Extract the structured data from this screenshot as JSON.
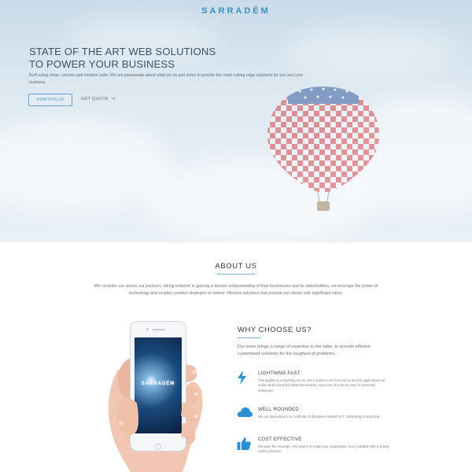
{
  "header": {
    "logo": "SARRADÉM"
  },
  "hero": {
    "title_line1": "STATE OF THE ART WEB SOLUTIONS",
    "title_line2": "TO POWER YOUR BUSINESS",
    "subtitle": "Built using clean, concise and modern code. We are passionate about what we do and strive to provide the most cutting edge solutions for you and your business.",
    "portfolio_button": "PORTFOLIO",
    "quote_button": "GET QUOTE",
    "quote_icon": "chevron-down-icon"
  },
  "about": {
    "title": "ABOUT US",
    "text": "We consider our clients our partners; taking initiative in gaining a deeper understanding of their businesses and its stakeholders, we leverage the power of technology and employ creative strategies to deliver effective solutions that provide our clients with significant value."
  },
  "phone": {
    "screen_logo": "SARRADÉM"
  },
  "why": {
    "title": "WHY CHOOSE US?",
    "text": "Our team brings a range of expertise to the table, to provide efficient, customised solutions for the toughest of problems.",
    "features": [
      {
        "icon": "lightning-bolt-icon",
        "title": "LIGHTNING FAST",
        "text": "This applies to everything we do: we're quick on our feet and so are the applications we make! Build using the latest frameworks, every line of code we write is extremely deliberate!"
      },
      {
        "icon": "cloud-icon",
        "title": "WELL ROUNDED",
        "text": "We are specialized in a multitude of disciplines related to IT, Advertising & Branding."
      },
      {
        "icon": "thumbs-up-icon",
        "title": "COST EFFECTIVE",
        "text": "We push the envelope. Our goal is to make your organization more valuable with a strong online presence."
      }
    ]
  },
  "colors": {
    "accent": "#3c8fc1",
    "icon_blue": "#2b8fd6",
    "text_dark": "#333333",
    "text_muted": "#6f7478"
  }
}
